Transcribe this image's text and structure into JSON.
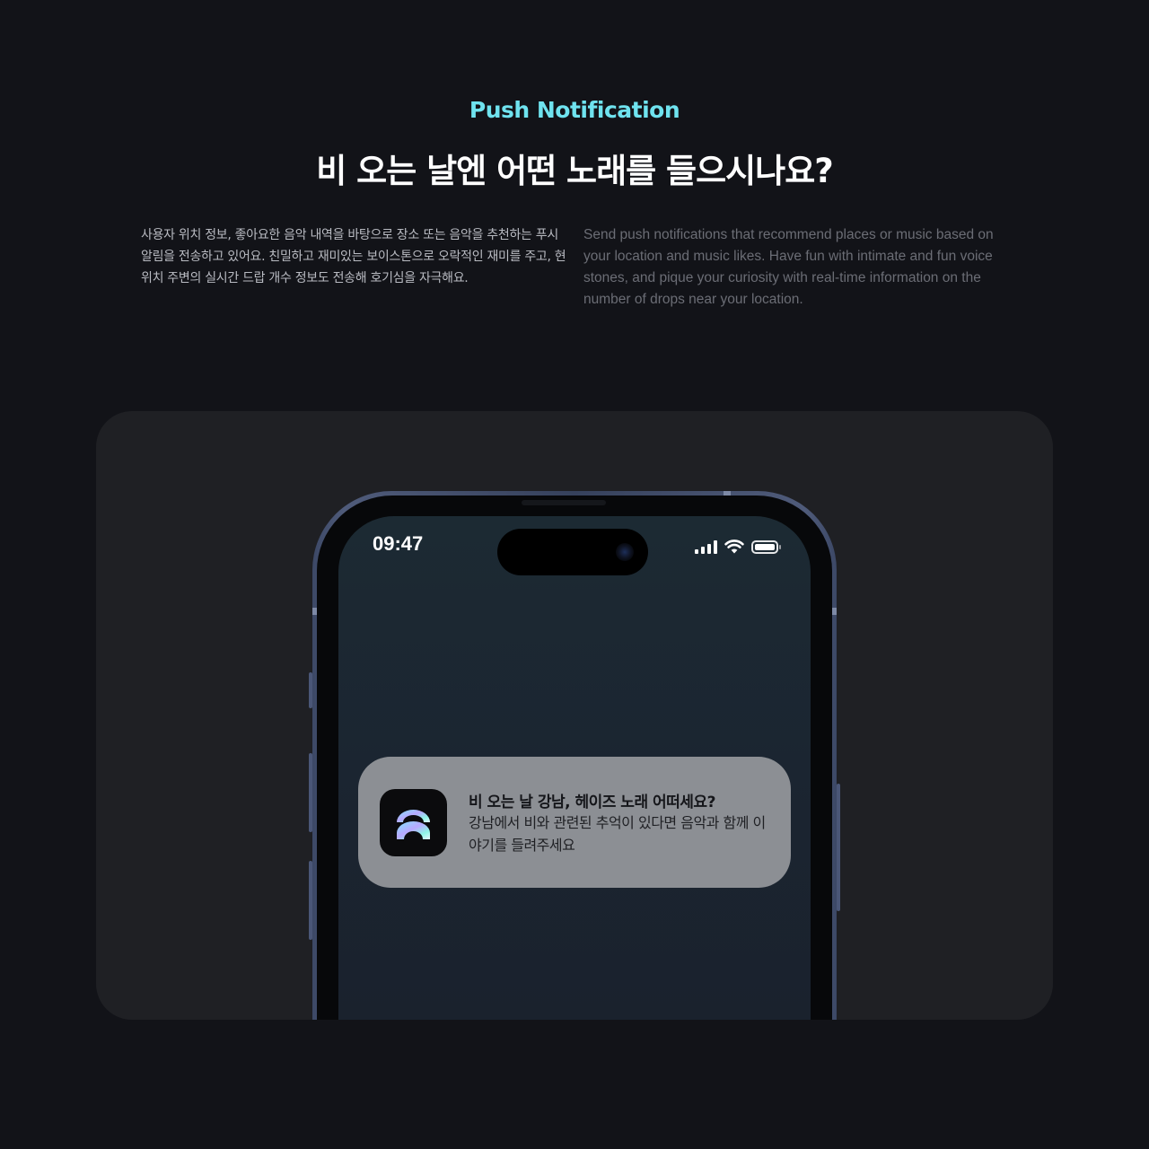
{
  "header": {
    "eyebrow": "Push Notification",
    "headline": "비 오는 날엔 어떤 노래를 들으시나요?"
  },
  "description": {
    "korean": "사용자 위치 정보, 좋아요한 음악 내역을 바탕으로 장소 또는 음악을 추천하는 푸시 알림을 전송하고 있어요. 친밀하고 재미있는 보이스톤으로 오락적인 재미를 주고, 현위치 주변의 실시간 드랍 개수 정보도 전송해 호기심을 자극해요.",
    "english": "Send push notifications that recommend places or music based on your location and music likes. Have fun with intimate and fun voice stones, and pique your curiosity with real-time information on the number of drops near your location."
  },
  "phone": {
    "status_bar": {
      "time": "09:47",
      "icons": [
        "signal-icon",
        "wifi-icon",
        "battery-icon"
      ],
      "battery_level": 1.0
    },
    "notification": {
      "app_icon": "app-logo-icon",
      "title": "비 오는 날 강남, 헤이즈 노래 어떠세요?",
      "body": "강남에서 비와 관련된 추억이 있다면 음악과 함께 이야기를 들려주세요"
    }
  },
  "colors": {
    "page_background": "#121318",
    "accent": "#6fe3ef",
    "stage_background": "#1f2024",
    "phone_frame": "#3c4866",
    "notification_background": "#8c8f94"
  }
}
